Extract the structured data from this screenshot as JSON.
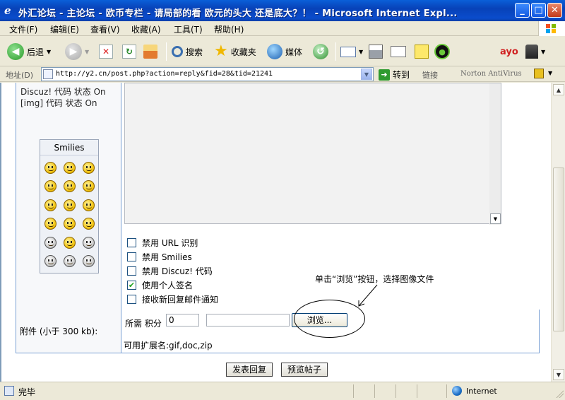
{
  "window": {
    "title": "外汇论坛 - 主论坛 - 欧币专栏 - 请局部的看 欧元的头大 还是底大？！ - Microsoft Internet Expl..."
  },
  "menu": [
    "文件(F)",
    "编辑(E)",
    "查看(V)",
    "收藏(A)",
    "工具(T)",
    "帮助(H)"
  ],
  "toolbar": {
    "back_label": "后退",
    "search_label": "搜索",
    "favorites_label": "收藏夹",
    "media_label": "媒体"
  },
  "address": {
    "label": "地址(D)",
    "url": "http://y2.cn/post.php?action=reply&fid=28&tid=21241",
    "go_label": "转到",
    "links_label": "链接",
    "norton_label": "Norton AntiVirus"
  },
  "left_panel": {
    "line1": "Discuz! 代码 状态 On",
    "line2": "[img] 代码 状态 On",
    "smilies_title": "Smilies"
  },
  "options": [
    {
      "label": "禁用 URL 识别",
      "checked": false
    },
    {
      "label": "禁用 Smilies",
      "checked": false
    },
    {
      "label": "禁用 Discuz! 代码",
      "checked": false
    },
    {
      "label": "使用个人签名",
      "checked": true
    },
    {
      "label": "接收新回复邮件通知",
      "checked": false
    }
  ],
  "attachment": {
    "label": "附件 (小于 300 kb):",
    "required_label": "所需 积分",
    "score_value": "0",
    "browse_label": "浏览...",
    "extensions_label": "可用扩展名:gif,doc,zip"
  },
  "annotation": {
    "hint": "单击“浏览”按钮，选择图像文件"
  },
  "buttons": {
    "submit_reply": "发表回复",
    "preview_post": "预览帖子"
  },
  "status": {
    "text": "完毕",
    "zone": "Internet"
  }
}
